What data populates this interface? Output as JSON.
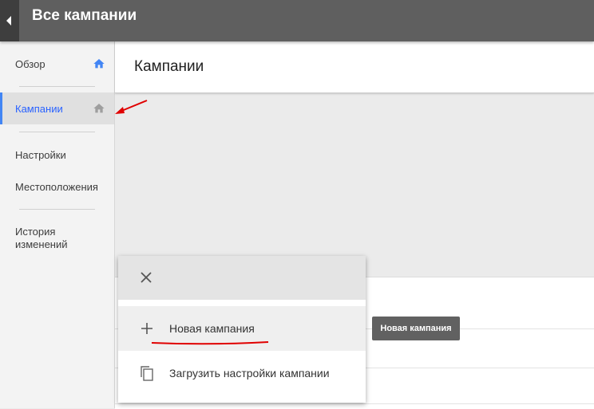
{
  "header": {
    "title": "Все кампании"
  },
  "sidebar": {
    "items": [
      {
        "label": "Обзор"
      },
      {
        "label": "Кампании"
      },
      {
        "label": "Настройки"
      },
      {
        "label": "Местоположения"
      },
      {
        "label": "История изменений"
      }
    ]
  },
  "main": {
    "title": "Кампании"
  },
  "fab_menu": {
    "items": [
      {
        "label": "Новая кампания",
        "icon": "plus-icon"
      },
      {
        "label": "Загрузить настройки кампании",
        "icon": "copy-icon"
      }
    ]
  },
  "tooltip": {
    "text": "Новая кампания"
  },
  "colors": {
    "accent": "#4285f4",
    "annotation": "#e00000",
    "topbar": "#5f5f5f"
  }
}
